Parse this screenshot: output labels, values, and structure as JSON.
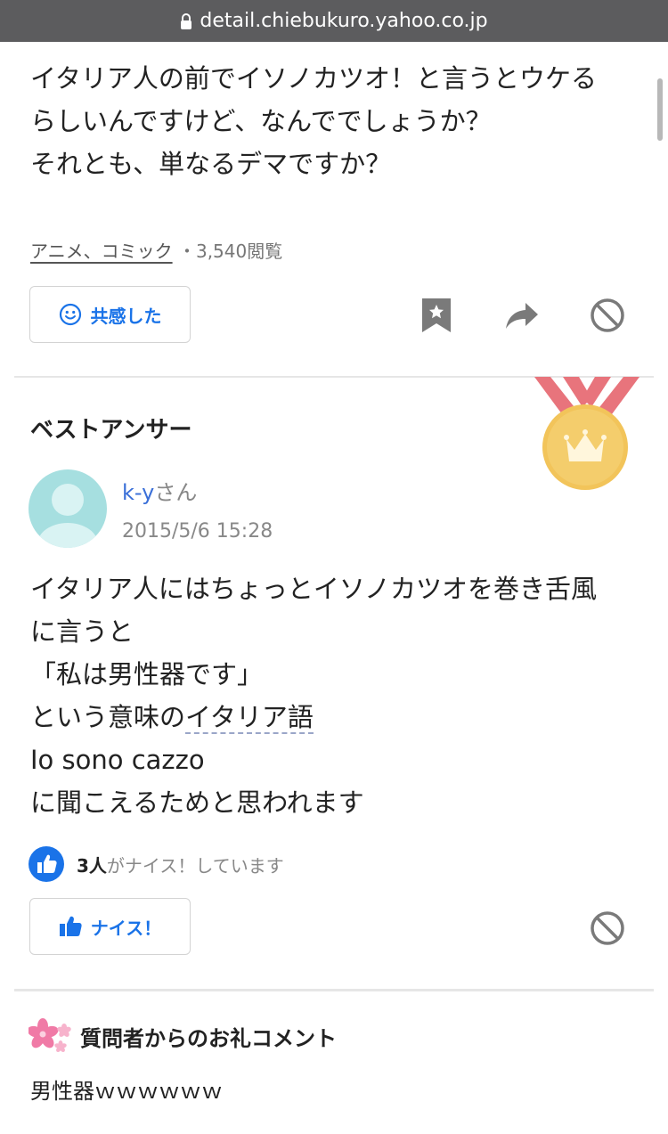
{
  "browser": {
    "url": "detail.chiebukuro.yahoo.co.jp"
  },
  "question": {
    "lines": [
      "イタリア人の前でイソノカツオ！と言うとウケる",
      "らしいんですけど、なんででしょうか？",
      "それとも、単なるデマですか？"
    ],
    "category": "アニメ、コミック",
    "separator": "・",
    "views": "3,540閲覧",
    "empathy_label": "共感した"
  },
  "best_answer": {
    "section_title": "ベストアンサー",
    "user_name": "k-y",
    "user_suffix": "さん",
    "timestamp": "2015/5/6 15:28",
    "lines": {
      "l1": "イタリア人にはちょっとイソノカツオを巻き舌風",
      "l2": "に言うと",
      "l3": "「私は男性器です」",
      "l4_pre": "という意味の",
      "l4_link": "イタリア語",
      "l5": "Io sono cazzo",
      "l6": "に聞こえるためと思われます"
    },
    "nice_count": "3人",
    "nice_text": "がナイス！しています",
    "nice_label": "ナイス！"
  },
  "thanks": {
    "title": "質問者からのお礼コメント",
    "text": "男性器ｗｗｗｗｗｗ"
  },
  "colors": {
    "accent": "#1a73e8",
    "user_link": "#3a6fd8",
    "medal_gold": "#f2c45a",
    "ribbon": "#e8747c"
  }
}
